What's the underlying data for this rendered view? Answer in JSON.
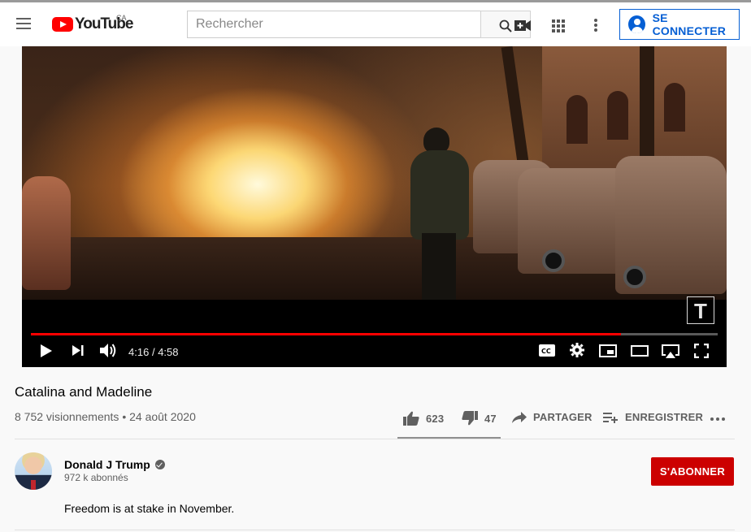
{
  "masthead": {
    "logo_text": "YouTube",
    "country_code": "CA",
    "search_placeholder": "Rechercher",
    "signin_label": "SE CONNECTER"
  },
  "player": {
    "current_time": "4:16",
    "separator": "/",
    "duration": "4:58",
    "progress_fraction": 0.859,
    "watermark_letter": "T",
    "controls_icons": [
      "play-icon",
      "next-icon",
      "volume-icon",
      "captions-icon",
      "settings-icon",
      "miniplayer-icon",
      "theater-icon",
      "airplay-icon",
      "fullscreen-icon"
    ]
  },
  "video": {
    "title": "Catalina and Madeline",
    "views": "8 752 visionnements",
    "dot": "•",
    "date": "24 août 2020",
    "likes": "623",
    "dislikes": "47",
    "like_ratio": 0.93,
    "share_label": "PARTAGER",
    "save_label": "ENREGISTRER"
  },
  "owner": {
    "name": "Donald J Trump",
    "subscribers": "972 k abonnés",
    "subscribe_label": "S'ABONNER"
  },
  "description": "Freedom is at stake in November.",
  "colors": {
    "brand_red": "#ff0000",
    "subscribe_red": "#cc0000",
    "link_blue": "#065fd4",
    "text_secondary": "#606060"
  }
}
